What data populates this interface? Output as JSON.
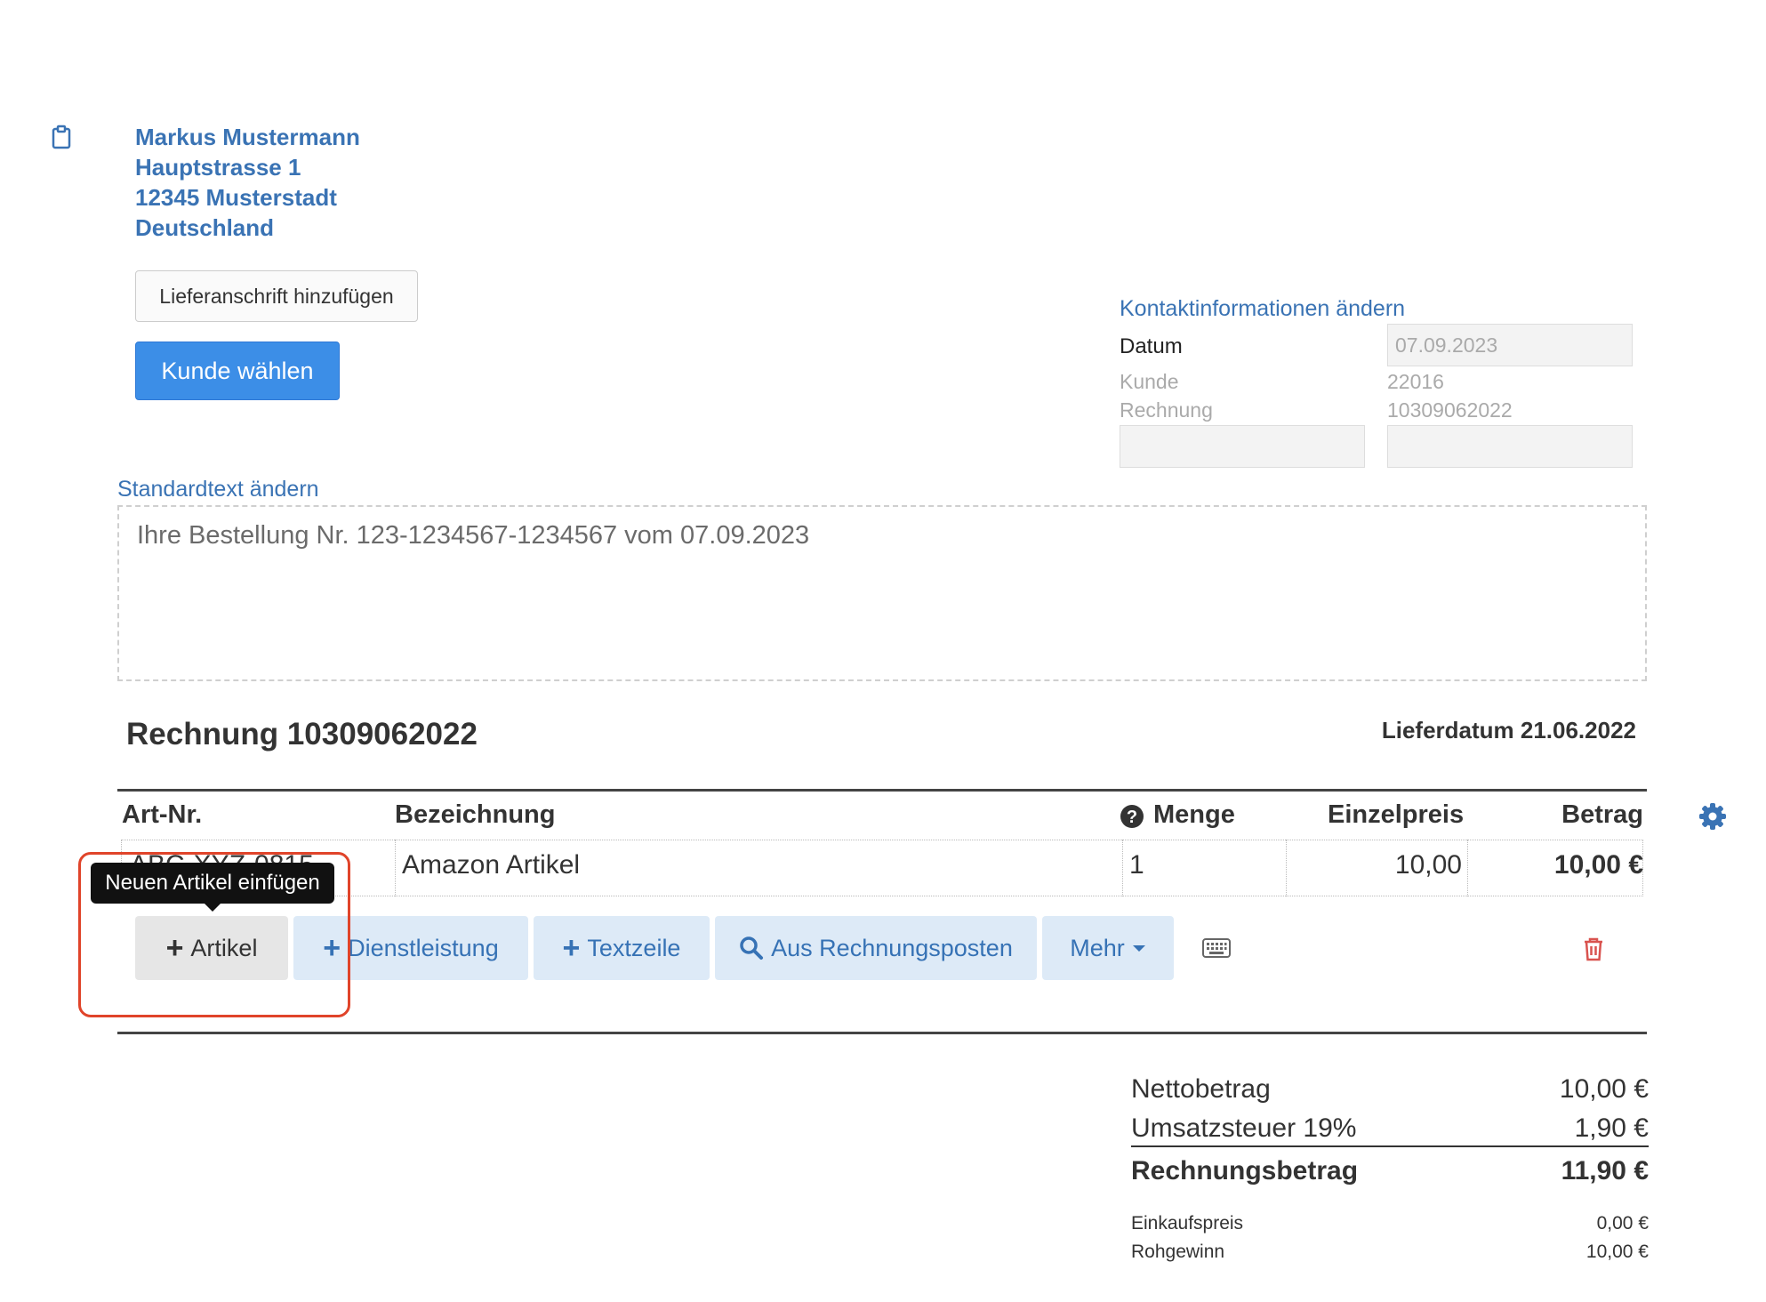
{
  "customer": {
    "name": "Markus Mustermann",
    "street": "Hauptstrasse 1",
    "city": "12345 Musterstadt",
    "country": "Deutschland"
  },
  "buttons": {
    "add_delivery_address": "Lieferanschrift hinzufügen",
    "choose_customer": "Kunde wählen"
  },
  "contact": {
    "edit_link": "Kontaktinformationen ändern",
    "date_label": "Datum",
    "date_value": "07.09.2023",
    "customer_label": "Kunde",
    "customer_value": "22016",
    "invoice_label": "Rechnung",
    "invoice_value": "10309062022"
  },
  "standard_text": {
    "edit_link": "Standardtext ändern",
    "content": "Ihre Bestellung Nr. 123-1234567-1234567 vom 07.09.2023"
  },
  "invoice": {
    "heading": "Rechnung 10309062022",
    "delivery_date": "Lieferdatum 21.06.2022"
  },
  "table": {
    "headers": {
      "art_nr": "Art-Nr.",
      "bezeichnung": "Bezeichnung",
      "menge": "Menge",
      "einzelpreis": "Einzelpreis",
      "betrag": "Betrag"
    },
    "rows": [
      {
        "art_nr": "ABC-XYZ-0815",
        "bezeichnung": "Amazon Artikel",
        "menge": "1",
        "einzelpreis": "10,00",
        "betrag": "10,00 €"
      }
    ]
  },
  "actions": {
    "artikel": "Artikel",
    "dienstleistung": "Dienstleistung",
    "textzeile": "Textzeile",
    "aus_rechnungsposten": "Aus Rechnungsposten",
    "mehr": "Mehr"
  },
  "tooltip": "Neuen Artikel einfügen",
  "totals": {
    "netto_label": "Nettobetrag",
    "netto_value": "10,00 €",
    "ust_label": "Umsatzsteuer 19%",
    "ust_value": "1,90 €",
    "gesamt_label": "Rechnungsbetrag",
    "gesamt_value": "11,90 €",
    "einkauf_label": "Einkaufspreis",
    "einkauf_value": "0,00 €",
    "rohgewinn_label": "Rohgewinn",
    "rohgewinn_value": "10,00 €"
  },
  "icons": {
    "clipboard": "clipboard-icon",
    "help": "question-circle-icon",
    "settings": "gear-icon",
    "keyboard": "keyboard-icon",
    "delete": "trash-icon",
    "search": "search-icon"
  },
  "colors": {
    "link_blue": "#3a73b4",
    "primary_button": "#3c8ee7",
    "action_button_bg": "#ddeaf7",
    "danger": "#d9534f",
    "highlight_outline": "#e0442a"
  }
}
